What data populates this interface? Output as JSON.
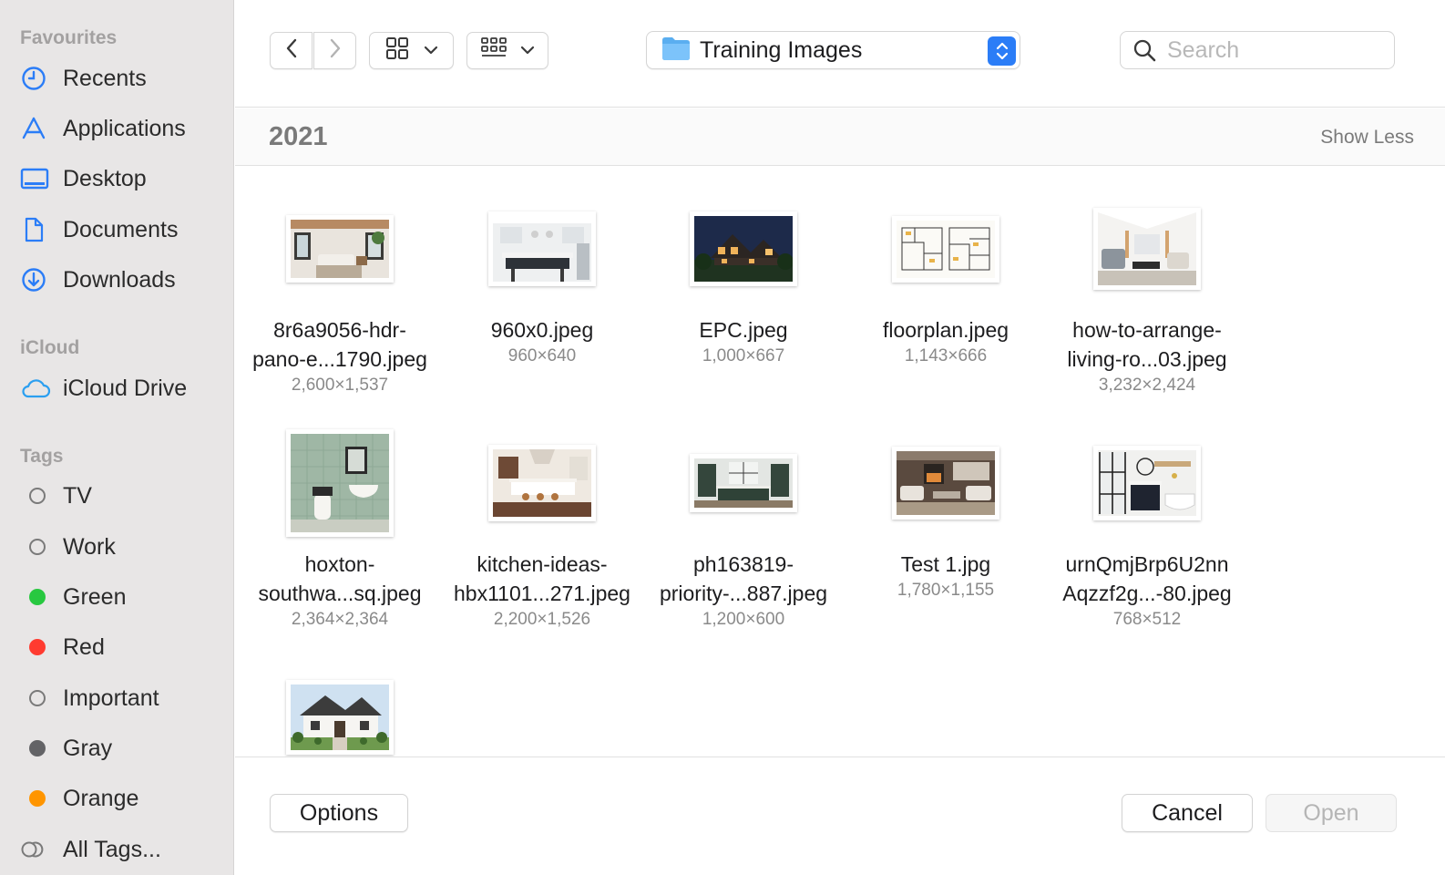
{
  "sidebar": {
    "favourites_heading": "Favourites",
    "favourites": [
      {
        "label": "Recents",
        "icon": "clock-icon"
      },
      {
        "label": "Applications",
        "icon": "applications-icon"
      },
      {
        "label": "Desktop",
        "icon": "desktop-icon"
      },
      {
        "label": "Documents",
        "icon": "document-icon"
      },
      {
        "label": "Downloads",
        "icon": "download-icon"
      }
    ],
    "icloud_heading": "iCloud",
    "icloud": [
      {
        "label": "iCloud Drive",
        "icon": "cloud-icon"
      }
    ],
    "tags_heading": "Tags",
    "tags": [
      {
        "label": "TV",
        "color": null
      },
      {
        "label": "Work",
        "color": null
      },
      {
        "label": "Green",
        "color": "#28c840"
      },
      {
        "label": "Red",
        "color": "#ff3b30"
      },
      {
        "label": "Important",
        "color": null
      },
      {
        "label": "Gray",
        "color": "#636366"
      },
      {
        "label": "Orange",
        "color": "#ff9500"
      },
      {
        "label": "All Tags...",
        "color": null
      }
    ]
  },
  "toolbar": {
    "current_folder": "Training Images",
    "search_placeholder": "Search",
    "accent_color": "#2b7df7"
  },
  "group": {
    "title": "2021",
    "toggle_label": "Show Less"
  },
  "files": [
    {
      "name": "8r6a9056-hdr-\npano-e...1790.jpeg",
      "dims": "2,600×1,537"
    },
    {
      "name": "960x0.jpeg",
      "dims": "960×640"
    },
    {
      "name": "EPC.jpeg",
      "dims": "1,000×667"
    },
    {
      "name": "floorplan.jpeg",
      "dims": "1,143×666"
    },
    {
      "name": "how-to-arrange-\nliving-ro...03.jpeg",
      "dims": "3,232×2,424"
    },
    {
      "name": "hoxton-\nsouthwa...sq.jpeg",
      "dims": "2,364×2,364"
    },
    {
      "name": "kitchen-ideas-\nhbx1101...271.jpeg",
      "dims": "2,200×1,526"
    },
    {
      "name": "ph163819-\npriority-...887.jpeg",
      "dims": "1,200×600"
    },
    {
      "name": "Test 1.jpg",
      "dims": "1,780×1,155"
    },
    {
      "name": "urnQmjBrp6U2nn\nAqzzf2g...-80.jpeg",
      "dims": "768×512"
    },
    {
      "name": "",
      "dims": ""
    }
  ],
  "footer": {
    "options_label": "Options",
    "cancel_label": "Cancel",
    "open_label": "Open"
  }
}
